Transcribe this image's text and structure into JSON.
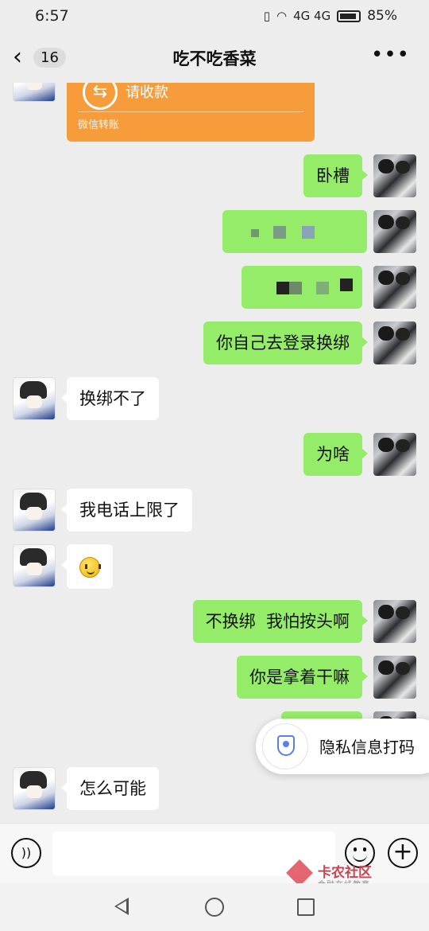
{
  "status_bar": {
    "time": "6:57",
    "network_icons": "4G 4G",
    "battery": "85%"
  },
  "nav": {
    "back_icon": "chevron-left-icon",
    "unread_count": "16",
    "title": "吃不吃香菜",
    "more_icon": "more-dots-icon"
  },
  "transfer": {
    "label": "请收款",
    "footer": "微信转账",
    "icon": "transfer-arrows-icon"
  },
  "messages": [
    {
      "side": "me",
      "text": "卧槽"
    },
    {
      "side": "me",
      "text": "",
      "redacted": true
    },
    {
      "side": "me",
      "text": "",
      "redacted": true
    },
    {
      "side": "me",
      "text": "你自己去登录换绑"
    },
    {
      "side": "other",
      "text": "换绑不了"
    },
    {
      "side": "me",
      "text": "为啥"
    },
    {
      "side": "other",
      "text": "我电话上限了"
    },
    {
      "side": "other",
      "text": "",
      "emoji": "smile-emoji-icon"
    },
    {
      "side": "me",
      "text": "不换绑  我怕按头啊"
    },
    {
      "side": "me",
      "text": "你是拿着干嘛"
    },
    {
      "side": "other",
      "text": "怎么可能"
    }
  ],
  "privacy_popup": {
    "text": "隐私信息打码",
    "icon": "shield-user-icon"
  },
  "input_bar": {
    "voice_icon": "voice-icon",
    "emoji_icon": "emoji-icon",
    "plus_icon": "plus-icon",
    "placeholder": ""
  },
  "watermark": {
    "name": "卡农社区",
    "sub": "金融在线教育"
  },
  "colors": {
    "background": "#ededed",
    "my_bubble": "#95ec69",
    "other_bubble": "#ffffff",
    "transfer_card": "#f79c3b"
  }
}
